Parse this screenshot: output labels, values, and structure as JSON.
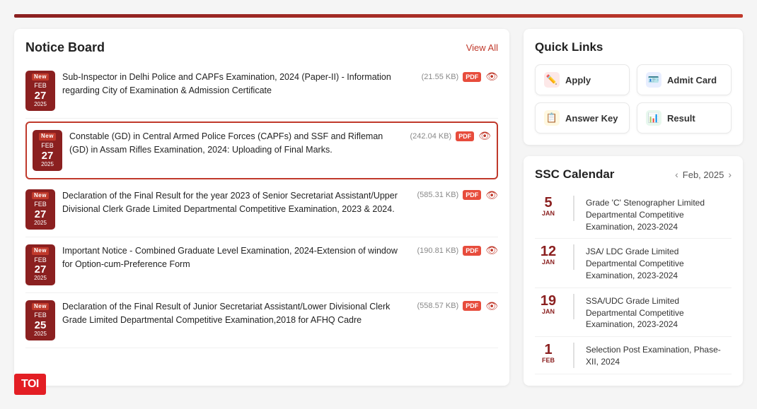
{
  "topBar": {},
  "noticeBoard": {
    "title": "Notice Board",
    "viewAllLabel": "View All",
    "items": [
      {
        "id": 1,
        "isNew": true,
        "month": "Feb",
        "day": "27",
        "year": "2025",
        "text": "Sub-Inspector in Delhi Police and CAPFs Examination, 2024 (Paper-II) - Information regarding City of Examination & Admission Certificate",
        "fileSize": "(21.55 KB)",
        "highlighted": false
      },
      {
        "id": 2,
        "isNew": true,
        "month": "Feb",
        "day": "27",
        "year": "2025",
        "text": "Constable (GD) in Central Armed Police Forces (CAPFs) and SSF and Rifleman (GD) in Assam Rifles Examination, 2024: Uploading of Final Marks.",
        "fileSize": "(242.04 KB)",
        "highlighted": true
      },
      {
        "id": 3,
        "isNew": true,
        "month": "Feb",
        "day": "27",
        "year": "2025",
        "text": "Declaration of the Final Result for the year 2023 of Senior Secretariat Assistant/Upper Divisional Clerk Grade Limited Departmental Competitive Examination, 2023 & 2024.",
        "fileSize": "(585.31 KB)",
        "highlighted": false
      },
      {
        "id": 4,
        "isNew": true,
        "month": "Feb",
        "day": "27",
        "year": "2025",
        "text": "Important Notice - Combined Graduate Level Examination, 2024-Extension of window for Option-cum-Preference Form",
        "fileSize": "(190.81 KB)",
        "highlighted": false
      },
      {
        "id": 5,
        "isNew": true,
        "month": "Feb",
        "day": "25",
        "year": "2025",
        "text": "Declaration of the Final Result of Junior Secretariat Assistant/Lower Divisional Clerk Grade Limited Departmental Competitive Examination,2018 for AFHQ Cadre",
        "fileSize": "(558.57 KB)",
        "highlighted": false
      }
    ]
  },
  "quickLinks": {
    "title": "Quick Links",
    "items": [
      {
        "id": "apply",
        "label": "Apply",
        "iconType": "apply",
        "icon": "✏️"
      },
      {
        "id": "admit",
        "label": "Admit Card",
        "iconType": "admit",
        "icon": "🪪"
      },
      {
        "id": "answer",
        "label": "Answer Key",
        "iconType": "answer",
        "icon": "📋"
      },
      {
        "id": "result",
        "label": "Result",
        "iconType": "result",
        "icon": "📊"
      }
    ]
  },
  "sscCalendar": {
    "title": "SSC Calendar",
    "nav": {
      "month": "Feb, 2025",
      "prevLabel": "‹",
      "nextLabel": "›"
    },
    "items": [
      {
        "day": "5",
        "month": "JAN",
        "text": "Grade 'C' Stenographer Limited Departmental Competitive Examination, 2023-2024"
      },
      {
        "day": "12",
        "month": "JAN",
        "text": "JSA/ LDC Grade Limited Departmental Competitive Examination, 2023-2024"
      },
      {
        "day": "19",
        "month": "JAN",
        "text": "SSA/UDC Grade Limited Departmental Competitive Examination, 2023-2024"
      },
      {
        "day": "1",
        "month": "FEB",
        "text": "Selection Post Examination, Phase-XII, 2024"
      }
    ]
  },
  "toi": {
    "label": "TOI"
  }
}
